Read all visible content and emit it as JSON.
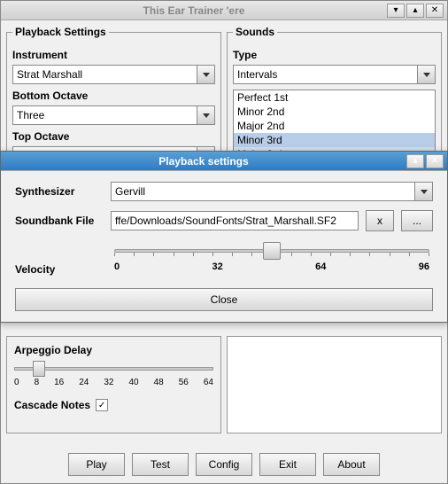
{
  "main": {
    "title": "This Ear Trainer 'ere",
    "playback_settings_legend": "Playback Settings",
    "instrument_label": "Instrument",
    "instrument_value": "Strat Marshall",
    "bottom_octave_label": "Bottom Octave",
    "bottom_octave_value": "Three",
    "top_octave_label": "Top Octave",
    "sounds_legend": "Sounds",
    "type_label": "Type",
    "type_value": "Intervals",
    "interval_items": [
      "Perfect 1st",
      "Minor 2nd",
      "Major 2nd",
      "Minor 3rd",
      "Major 3rd"
    ]
  },
  "dialog": {
    "title": "Playback settings",
    "synth_label": "Synthesizer",
    "synth_value": "Gervill",
    "soundbank_label": "Soundbank File",
    "soundbank_value": "ffe/Downloads/SoundFonts/Strat_Marshall.SF2",
    "clear_btn": "x",
    "browse_btn": "...",
    "velocity_label": "Velocity",
    "velocity_ticks": [
      "0",
      "32",
      "64",
      "96"
    ],
    "velocity_value": 64,
    "velocity_max": 127,
    "close_btn": "Close"
  },
  "arpeggio": {
    "label": "Arpeggio Delay",
    "ticks": [
      "0",
      "8",
      "16",
      "24",
      "32",
      "40",
      "48",
      "56",
      "64"
    ],
    "value": 8,
    "max": 64,
    "cascade_label": "Cascade Notes",
    "cascade_checked": true
  },
  "buttons": {
    "play": "Play",
    "test": "Test",
    "config": "Config",
    "exit": "Exit",
    "about": "About"
  },
  "chart_data": {
    "type": "table"
  }
}
